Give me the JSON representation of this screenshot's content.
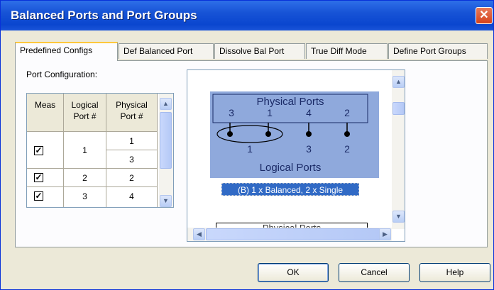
{
  "window": {
    "title": "Balanced Ports and Port Groups",
    "close_icon": "close-icon"
  },
  "tabs": [
    {
      "label": "Predefined Configs",
      "active": true
    },
    {
      "label": "Def Balanced Port",
      "active": false
    },
    {
      "label": "Dissolve Bal Port",
      "active": false
    },
    {
      "label": "True Diff Mode",
      "active": false
    },
    {
      "label": "Define Port Groups",
      "active": false
    }
  ],
  "port_config": {
    "label": "Port Configuration:",
    "columns": [
      {
        "line1": "Meas",
        "line2": ""
      },
      {
        "line1": "Logical",
        "line2": "Port #"
      },
      {
        "line1": "Physical",
        "line2": "Port #"
      }
    ],
    "rows": [
      {
        "meas": true,
        "logical": "1",
        "physical": [
          "1",
          "3"
        ]
      },
      {
        "meas": true,
        "logical": "2",
        "physical": [
          "2"
        ]
      },
      {
        "meas": true,
        "logical": "3",
        "physical": [
          "4"
        ]
      }
    ]
  },
  "preview": {
    "physical_label": "Physical Ports",
    "logical_label": "Logical Ports",
    "physical_numbers": [
      "3",
      "1",
      "4",
      "2"
    ],
    "logical_numbers": [
      "1",
      "3",
      "2"
    ],
    "caption": "(B) 1 x Balanced, 2 x Single",
    "next_label": "Physical Ports"
  },
  "buttons": {
    "ok": "OK",
    "cancel": "Cancel",
    "help": "Help"
  },
  "colors": {
    "title_bar": "#0a46cf",
    "diagram_bg": "#8fa9dc",
    "selection": "#316ac5",
    "dialog_bg": "#ece9d8"
  }
}
